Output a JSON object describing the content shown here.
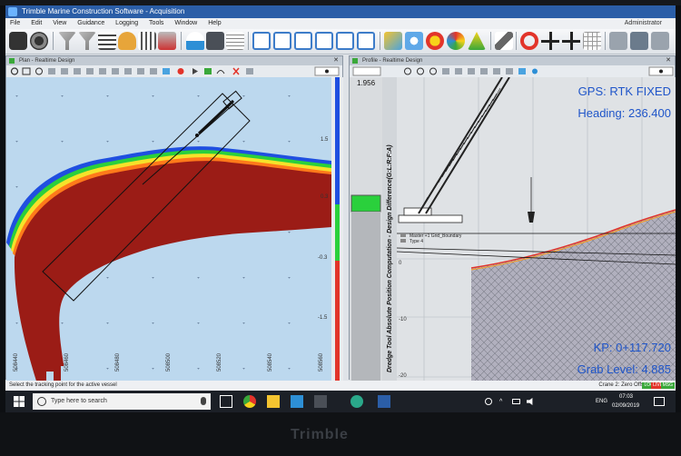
{
  "app": {
    "title": "Trimble Marine Construction Software - Acquisition",
    "user": "Administrator"
  },
  "menu": [
    "File",
    "Edit",
    "View",
    "Guidance",
    "Logging",
    "Tools",
    "Window",
    "Help"
  ],
  "toolbar": {
    "icons": [
      "camera-icon",
      "reel-icon",
      "filter-icon",
      "filter-icon",
      "sliders-icon",
      "bell-icon",
      "sliders-icon",
      "usb-icon",
      "boat-icon",
      "calculator-icon",
      "list-icon",
      "layout-icon",
      "layout-1-icon",
      "layout-2-icon",
      "layout-3-icon",
      "layout-4-icon",
      "weather-icon",
      "sun-icon",
      "sun-icon",
      "palette-icon",
      "alert-icon",
      "link-icon",
      "lifebuoy-icon",
      "target-add-icon",
      "target-add-icon",
      "grid-icon",
      "save-icon",
      "save-icon",
      "save-icon"
    ]
  },
  "panes": {
    "plan": {
      "title": "Plan - Realtime Design",
      "scale_labels": [
        "1.5",
        "0.3",
        "-0.3",
        "-1.5"
      ],
      "x_tick_labels": [
        "508440",
        "508460",
        "508480",
        "508500",
        "508520",
        "508540",
        "508560"
      ]
    },
    "profile": {
      "title": "Profile - Realtime Design",
      "depth_readout": "1.956",
      "axis_label": "Dredge Tool Absolute Position Computation - Design Difference(G:L:R:F:A)",
      "legend": [
        "Master +1 Grid_Boundary",
        "Type 4"
      ],
      "y_tick_labels": [
        "0",
        "-10",
        "-20"
      ],
      "gps_status": "GPS: RTK FIXED",
      "heading": "Heading: 236.400",
      "kp": "KP: 0+117.720",
      "grab_level": "Grab Level: 4.885"
    }
  },
  "status": {
    "message": "Select the tracking point for the active vessel",
    "right_text": "Crane 2: Zero Offset",
    "badges": [
      "LOG",
      "LIVE",
      "MSG"
    ]
  },
  "taskbar": {
    "search_placeholder": "Type here to search",
    "language": "ENG",
    "time": "07:03",
    "date": "02/09/2019"
  },
  "brand": "Trimble",
  "colors": {
    "title_bar": "#2b5ea7",
    "water": "#bcd8ee",
    "dredge_fill": "#9b1c16",
    "hud_text": "#1f55c9",
    "status_ok": "#3aa83a",
    "status_warn": "#e2342a"
  }
}
